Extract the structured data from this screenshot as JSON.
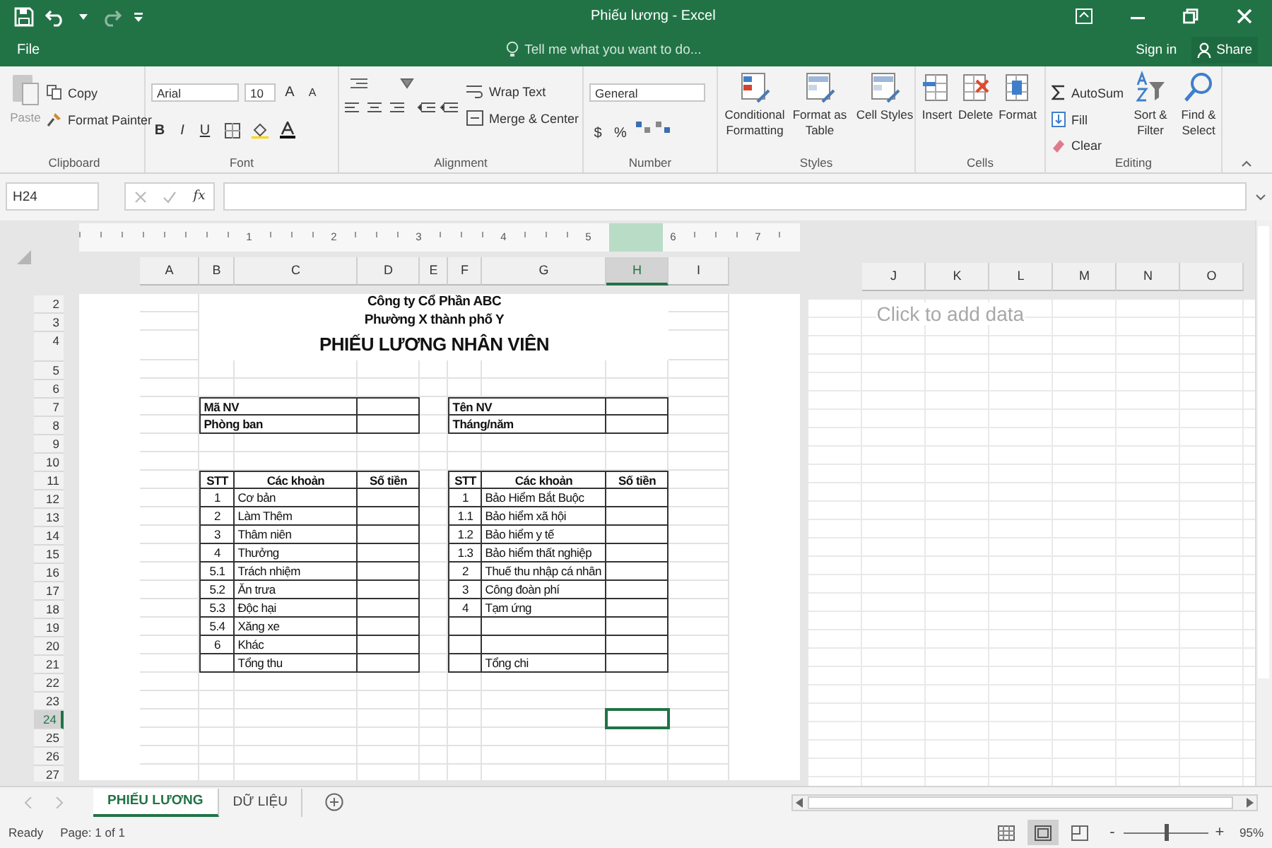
{
  "window": {
    "title": "Phiếu lương - Excel"
  },
  "menu": {
    "file": "File",
    "tell_me": {
      "placeholder": "Tell me what you want to do..."
    },
    "sign_in": "Sign in",
    "share": "Share"
  },
  "ribbon": {
    "clipboard": {
      "label": "Clipboard",
      "paste": {
        "label": "Paste",
        "disabled": true
      },
      "copy": "Copy",
      "format_painter": "Format Painter"
    },
    "font": {
      "label": "Font",
      "name": "Arial",
      "size": "10",
      "grow": "A",
      "shrink": "A",
      "bold": "B",
      "italic": "I",
      "underline": "U"
    },
    "alignment": {
      "label": "Alignment",
      "wrap_text": "Wrap Text",
      "merge_center": "Merge & Center"
    },
    "number": {
      "label": "Number",
      "format": "General",
      "currency": "$",
      "percent": "%"
    },
    "styles": {
      "label": "Styles",
      "buttons": [
        "Conditional Formatting",
        "Format as Table",
        "Cell Styles"
      ]
    },
    "cells": {
      "label": "Cells",
      "buttons": [
        "Insert",
        "Delete",
        "Format"
      ]
    },
    "editing": {
      "label": "Editing",
      "autosum": "AutoSum",
      "fill": "Fill",
      "clear": "Clear",
      "sort_filter": "Sort & Filter",
      "find_select": "Find & Select"
    }
  },
  "formula_bar": {
    "name_box": "H24",
    "fx": "fx"
  },
  "ruler": [
    "1",
    "2",
    "3",
    "4",
    "5",
    "6",
    "7"
  ],
  "columns": [
    {
      "label": "A",
      "selected": false
    },
    {
      "label": "B",
      "selected": false
    },
    {
      "label": "C",
      "selected": false
    },
    {
      "label": "D",
      "selected": false
    },
    {
      "label": "E",
      "selected": false
    },
    {
      "label": "F",
      "selected": false
    },
    {
      "label": "G",
      "selected": false
    },
    {
      "label": "H",
      "selected": true
    },
    {
      "label": "I",
      "selected": false
    }
  ],
  "rows": [
    {
      "label": "2",
      "selected": false
    },
    {
      "label": "3",
      "selected": false
    },
    {
      "label": "4",
      "selected": false
    },
    {
      "label": "5",
      "selected": false
    },
    {
      "label": "6",
      "selected": false
    },
    {
      "label": "7",
      "selected": false
    },
    {
      "label": "8",
      "selected": false
    },
    {
      "label": "9",
      "selected": false
    },
    {
      "label": "10",
      "selected": false
    },
    {
      "label": "11",
      "selected": false
    },
    {
      "label": "12",
      "selected": false
    },
    {
      "label": "13",
      "selected": false
    },
    {
      "label": "14",
      "selected": false
    },
    {
      "label": "15",
      "selected": false
    },
    {
      "label": "16",
      "selected": false
    },
    {
      "label": "17",
      "selected": false
    },
    {
      "label": "18",
      "selected": false
    },
    {
      "label": "19",
      "selected": false
    },
    {
      "label": "20",
      "selected": false
    },
    {
      "label": "21",
      "selected": false
    },
    {
      "label": "22",
      "selected": false
    },
    {
      "label": "23",
      "selected": false
    },
    {
      "label": "24",
      "selected": true
    },
    {
      "label": "25",
      "selected": false
    },
    {
      "label": "26",
      "selected": false
    },
    {
      "label": "27",
      "selected": false
    }
  ],
  "sheet": {
    "title_lines": [
      "Công ty Cổ Phần ABC",
      "Phường X thành phố Y",
      "PHIẾU LƯƠNG NHÂN VIÊN"
    ],
    "info": [
      {
        "left": "Mã NV",
        "right": "Tên NV"
      },
      {
        "left": "Phòng ban",
        "right": "Tháng/năm"
      }
    ],
    "income": {
      "headers": [
        "STT",
        "Các khoản",
        "Số tiền"
      ],
      "rows": [
        {
          "stt": "1",
          "item": "Cơ bản"
        },
        {
          "stt": "2",
          "item": "Làm Thêm"
        },
        {
          "stt": "3",
          "item": "Thâm niên"
        },
        {
          "stt": "4",
          "item": "Thưởng"
        },
        {
          "stt": "5.1",
          "item": "Trách nhiệm"
        },
        {
          "stt": "5.2",
          "item": "Ăn trưa"
        },
        {
          "stt": "5.3",
          "item": "Độc hại"
        },
        {
          "stt": "5.4",
          "item": "Xăng xe"
        },
        {
          "stt": "6",
          "item": "Khác"
        },
        {
          "item": "Tổng thu"
        }
      ]
    },
    "deductions": {
      "headers": [
        "STT",
        "Các khoản",
        "Số tiền"
      ],
      "rows": [
        {
          "stt": "1",
          "item": "Bảo Hiểm Bắt Buộc"
        },
        {
          "stt": "1.1",
          "item": "Bảo hiểm xã hội"
        },
        {
          "stt": "1.2",
          "item": "Bảo hiểm y tế"
        },
        {
          "stt": "1.3",
          "item": "Bảo hiểm thất nghiệp"
        },
        {
          "stt": "2",
          "item": "Thuế thu nhập cá nhân"
        },
        {
          "stt": "3",
          "item": "Công đoàn phí"
        },
        {
          "stt": "4",
          "item": "Tạm ứng"
        },
        {},
        {},
        {
          "item": "Tổng chi"
        }
      ]
    }
  },
  "next_page": {
    "columns": [
      "J",
      "K",
      "L",
      "M",
      "N",
      "O"
    ],
    "placeholder": "Click to add data"
  },
  "sheet_tabs": [
    {
      "label": "PHIẾU LƯƠNG",
      "selected": true
    },
    {
      "label": "DỮ LIỆU",
      "selected": false
    }
  ],
  "status_bar": {
    "ready": "Ready",
    "page": "Page: 1 of 1",
    "views": [
      {
        "kind": "normal",
        "selected": false
      },
      {
        "kind": "page_layout",
        "selected": true
      },
      {
        "kind": "page_break",
        "selected": false
      }
    ],
    "zoom": {
      "minus": "-",
      "plus": "+",
      "level": 0.5,
      "reading": "95%"
    }
  }
}
